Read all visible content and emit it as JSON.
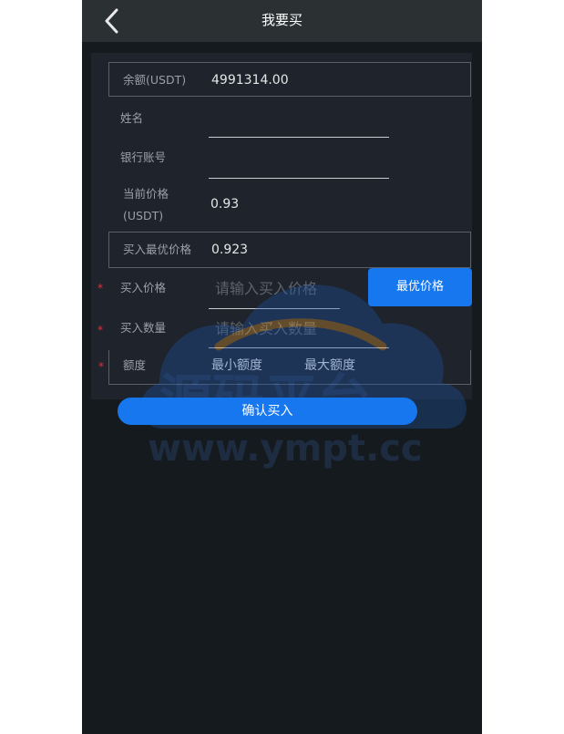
{
  "header": {
    "title": "我要买",
    "back_icon": "chevron-left-icon"
  },
  "form": {
    "balance": {
      "label": "余额(USDT)",
      "value": "4991314.00"
    },
    "name": {
      "label": "姓名",
      "value": ""
    },
    "bank_account": {
      "label": "银行账号",
      "value": ""
    },
    "current_price": {
      "label_line1": "当前价格",
      "label_line2": "(USDT)",
      "value": "0.93"
    },
    "best_buy_price": {
      "label": "买入最优价格",
      "value": "0.923"
    },
    "buy_price": {
      "required_mark": "*",
      "label": "买入价格",
      "placeholder": "请输入买入价格"
    },
    "buy_quantity": {
      "required_mark": "*",
      "label": "买入数量",
      "placeholder": "请输入买入数量"
    },
    "amount_limit": {
      "required_mark": "*",
      "label": "额度",
      "min_label": "最小额度",
      "max_label": "最大额度"
    },
    "best_price_button": "最优价格",
    "confirm_button": "确认买入"
  },
  "watermark": {
    "text": "www.ympt.cc",
    "logo_text": "源码平台"
  },
  "colors": {
    "accent": "#1677ef",
    "background": "#151a1e",
    "header": "#2b3033",
    "card": "#1e232c",
    "required": "#e8303a"
  }
}
